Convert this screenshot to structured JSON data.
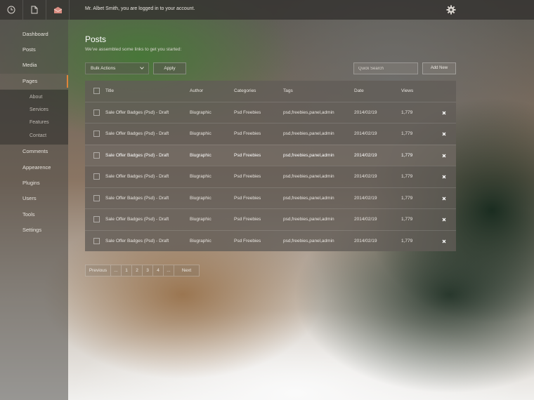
{
  "header": {
    "welcome_text": "Mr. Albet Smith, you are logged in to your account.",
    "icons": [
      "clock-icon",
      "document-icon",
      "mail-icon"
    ],
    "settings_icon": "gear-icon"
  },
  "sidebar": {
    "items": [
      {
        "label": "Dashboard"
      },
      {
        "label": "Posts"
      },
      {
        "label": "Media"
      },
      {
        "label": "Pages",
        "active": true
      },
      {
        "label": "Comments"
      },
      {
        "label": "Appearence"
      },
      {
        "label": "Plugins"
      },
      {
        "label": "Users"
      },
      {
        "label": "Tools"
      },
      {
        "label": "Settings"
      }
    ],
    "subitems": [
      {
        "label": "About"
      },
      {
        "label": "Services"
      },
      {
        "label": "Features"
      },
      {
        "label": "Contact"
      }
    ]
  },
  "main": {
    "title": "Posts",
    "subtitle": "We've assembled some links to get you started:",
    "bulk_actions": "Bulk Actions",
    "apply_label": "Apply",
    "search_placeholder": "Quick Search",
    "add_new_label": "Add New"
  },
  "table": {
    "columns": [
      "Title",
      "Author",
      "Categories",
      "Tags",
      "Date",
      "Views"
    ],
    "rows": [
      {
        "title": "Sale Offer Badges (Psd) - Draft",
        "author": "Biugraphic",
        "category": "Psd Freebies",
        "tags": "psd,freebies,panel,admin",
        "date": "2014/02/19",
        "views": "1,779"
      },
      {
        "title": "Sale Offer Badges (Psd) - Draft",
        "author": "Biugraphic",
        "category": "Psd Freebies",
        "tags": "psd,freebies,panel,admin",
        "date": "2014/02/19",
        "views": "1,779"
      },
      {
        "title": "Sale Offer Badges (Psd) - Draft",
        "author": "Biugraphic",
        "category": "Psd Freebies",
        "tags": "psd,freebies,panel,admin",
        "date": "2014/02/19",
        "views": "1,779",
        "highlighted": true
      },
      {
        "title": "Sale Offer Badges (Psd) - Draft",
        "author": "Biugraphic",
        "category": "Psd Freebies",
        "tags": "psd,freebies,panel,admin",
        "date": "2014/02/19",
        "views": "1,779"
      },
      {
        "title": "Sale Offer Badges (Psd) - Draft",
        "author": "Biugraphic",
        "category": "Psd Freebies",
        "tags": "psd,freebies,panel,admin",
        "date": "2014/02/19",
        "views": "1,779"
      },
      {
        "title": "Sale Offer Badges (Psd) - Draft",
        "author": "Biugraphic",
        "category": "Psd Freebies",
        "tags": "psd,freebies,panel,admin",
        "date": "2014/02/19",
        "views": "1,779"
      },
      {
        "title": "Sale Offer Badges (Psd) - Draft",
        "author": "Biugraphic",
        "category": "Psd Freebies",
        "tags": "psd,freebies,panel,admin",
        "date": "2014/02/19",
        "views": "1,779"
      }
    ],
    "delete_icon": "close-icon"
  },
  "pagination": {
    "previous": "Previous",
    "items": [
      "...",
      "1",
      "2",
      "3",
      "4",
      "..."
    ],
    "next": "Next"
  },
  "colors": {
    "accent": "#e0843a",
    "mail_icon": "#d98c80"
  }
}
